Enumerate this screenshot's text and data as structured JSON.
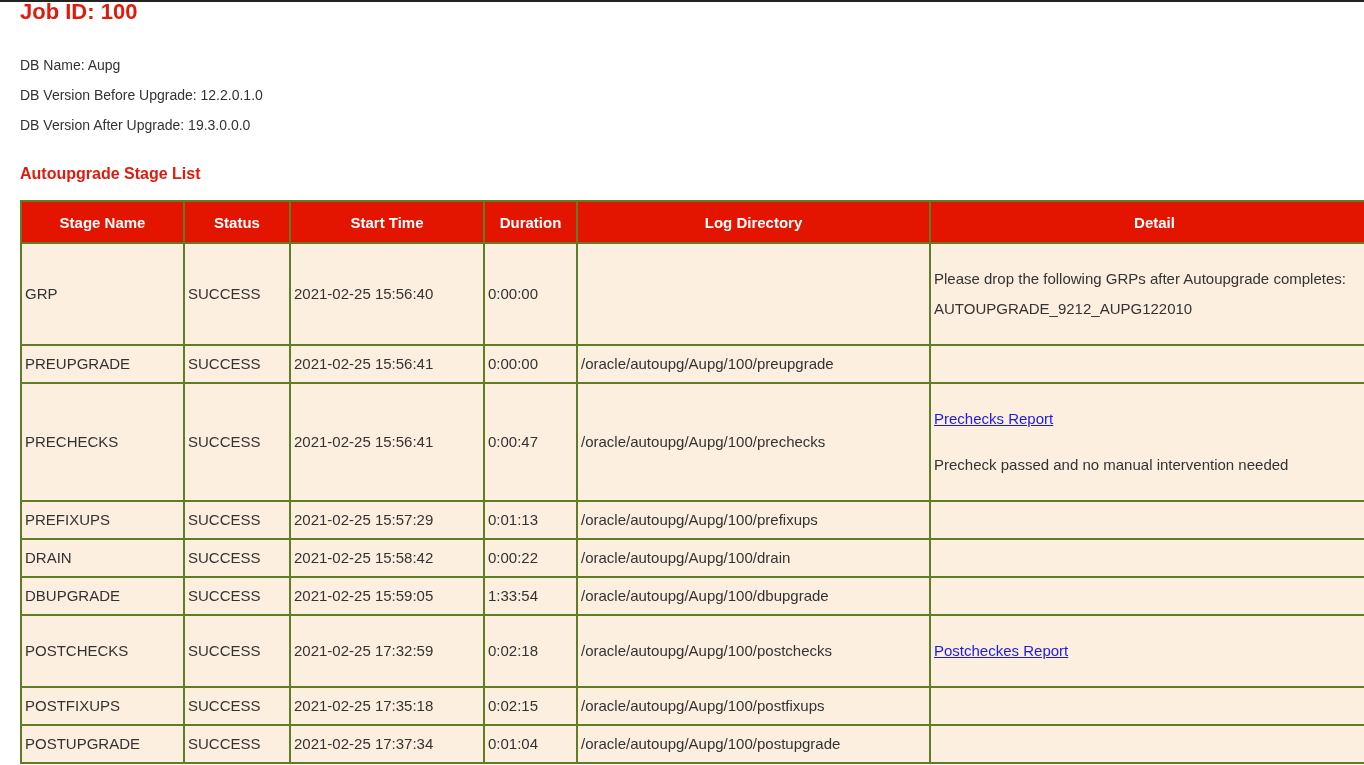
{
  "title": "Job ID: 100",
  "info": [
    "DB Name: Aupg",
    "DB Version Before Upgrade: 12.2.0.1.0",
    "DB Version After Upgrade: 19.3.0.0.0"
  ],
  "section_title": "Autoupgrade Stage List",
  "table": {
    "columns": [
      "Stage Name",
      "Status",
      "Start Time",
      "Duration",
      "Log Directory",
      "Detail"
    ],
    "rows": [
      {
        "stage": "GRP",
        "status": "SUCCESS",
        "start": "2021-02-25 15:56:40",
        "duration": "0:00:00",
        "log": "",
        "detail": [
          {
            "kind": "text",
            "lines": [
              "Please drop the following GRPs after Autoupgrade completes:",
              "AUTOUPGRADE_9212_AUPG122010"
            ]
          }
        ]
      },
      {
        "stage": "PREUPGRADE",
        "status": "SUCCESS",
        "start": "2021-02-25 15:56:41",
        "duration": "0:00:00",
        "log": "/oracle/autoupg/Aupg/100/preupgrade",
        "detail": []
      },
      {
        "stage": "PRECHECKS",
        "status": "SUCCESS",
        "start": "2021-02-25 15:56:41",
        "duration": "0:00:47",
        "log": "/oracle/autoupg/Aupg/100/prechecks",
        "detail": [
          {
            "kind": "link",
            "text": "Prechecks Report"
          },
          {
            "kind": "text",
            "lines": [
              "Precheck passed and no manual intervention needed"
            ]
          }
        ]
      },
      {
        "stage": "PREFIXUPS",
        "status": "SUCCESS",
        "start": "2021-02-25 15:57:29",
        "duration": "0:01:13",
        "log": "/oracle/autoupg/Aupg/100/prefixups",
        "detail": []
      },
      {
        "stage": "DRAIN",
        "status": "SUCCESS",
        "start": "2021-02-25 15:58:42",
        "duration": "0:00:22",
        "log": "/oracle/autoupg/Aupg/100/drain",
        "detail": []
      },
      {
        "stage": "DBUPGRADE",
        "status": "SUCCESS",
        "start": "2021-02-25 15:59:05",
        "duration": "1:33:54",
        "log": "/oracle/autoupg/Aupg/100/dbupgrade",
        "detail": []
      },
      {
        "stage": "POSTCHECKS",
        "status": "SUCCESS",
        "start": "2021-02-25 17:32:59",
        "duration": "0:02:18",
        "log": "/oracle/autoupg/Aupg/100/postchecks",
        "detail": [
          {
            "kind": "link",
            "text": "Postcheckes Report"
          }
        ]
      },
      {
        "stage": "POSTFIXUPS",
        "status": "SUCCESS",
        "start": "2021-02-25 17:35:18",
        "duration": "0:02:15",
        "log": "/oracle/autoupg/Aupg/100/postfixups",
        "detail": []
      },
      {
        "stage": "POSTUPGRADE",
        "status": "SUCCESS",
        "start": "2021-02-25 17:37:34",
        "duration": "0:01:04",
        "log": "/oracle/autoupg/Aupg/100/postupgrade",
        "detail": []
      }
    ]
  }
}
